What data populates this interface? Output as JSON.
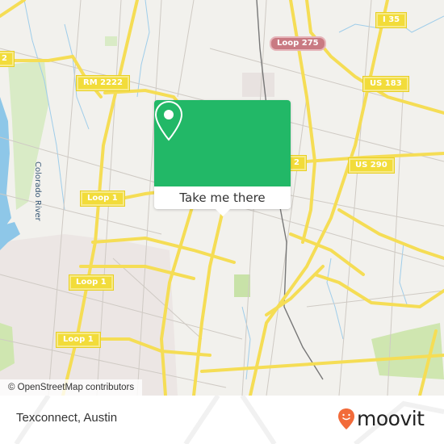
{
  "map": {
    "road_labels": [
      {
        "id": "i35",
        "text": "I 35",
        "style": "yellow"
      },
      {
        "id": "loop275",
        "text": "Loop 275",
        "style": "red"
      },
      {
        "id": "us183",
        "text": "US 183",
        "style": "yellow"
      },
      {
        "id": "rm2222",
        "text": "RM 2222",
        "style": "yellow"
      },
      {
        "id": "rm2222-edge",
        "text": "2",
        "style": "yellow"
      },
      {
        "id": "us290",
        "text": "US 290",
        "style": "yellow"
      },
      {
        "id": "us290-edge",
        "text": "2",
        "style": "yellow"
      },
      {
        "id": "loop1-a",
        "text": "Loop 1",
        "style": "yellow"
      },
      {
        "id": "loop1-b",
        "text": "Loop 1",
        "style": "yellow"
      },
      {
        "id": "loop1-c",
        "text": "Loop 1",
        "style": "yellow"
      }
    ],
    "water_labels": [
      {
        "id": "colorado-river",
        "text": "Colorado River"
      }
    ],
    "attribution": "© OpenStreetMap contributors",
    "colors": {
      "land": "#f2f1ed",
      "highway": "#f5dd55",
      "water": "#8ec7e8",
      "park": "#cfe6b0",
      "popup_green": "#22b867"
    }
  },
  "popup": {
    "icon": "location-pin-icon",
    "button_label": "Take me there"
  },
  "footer": {
    "place_name": "Texconnect, Austin",
    "brand": "moovit",
    "brand_color": "#f26b3a"
  }
}
